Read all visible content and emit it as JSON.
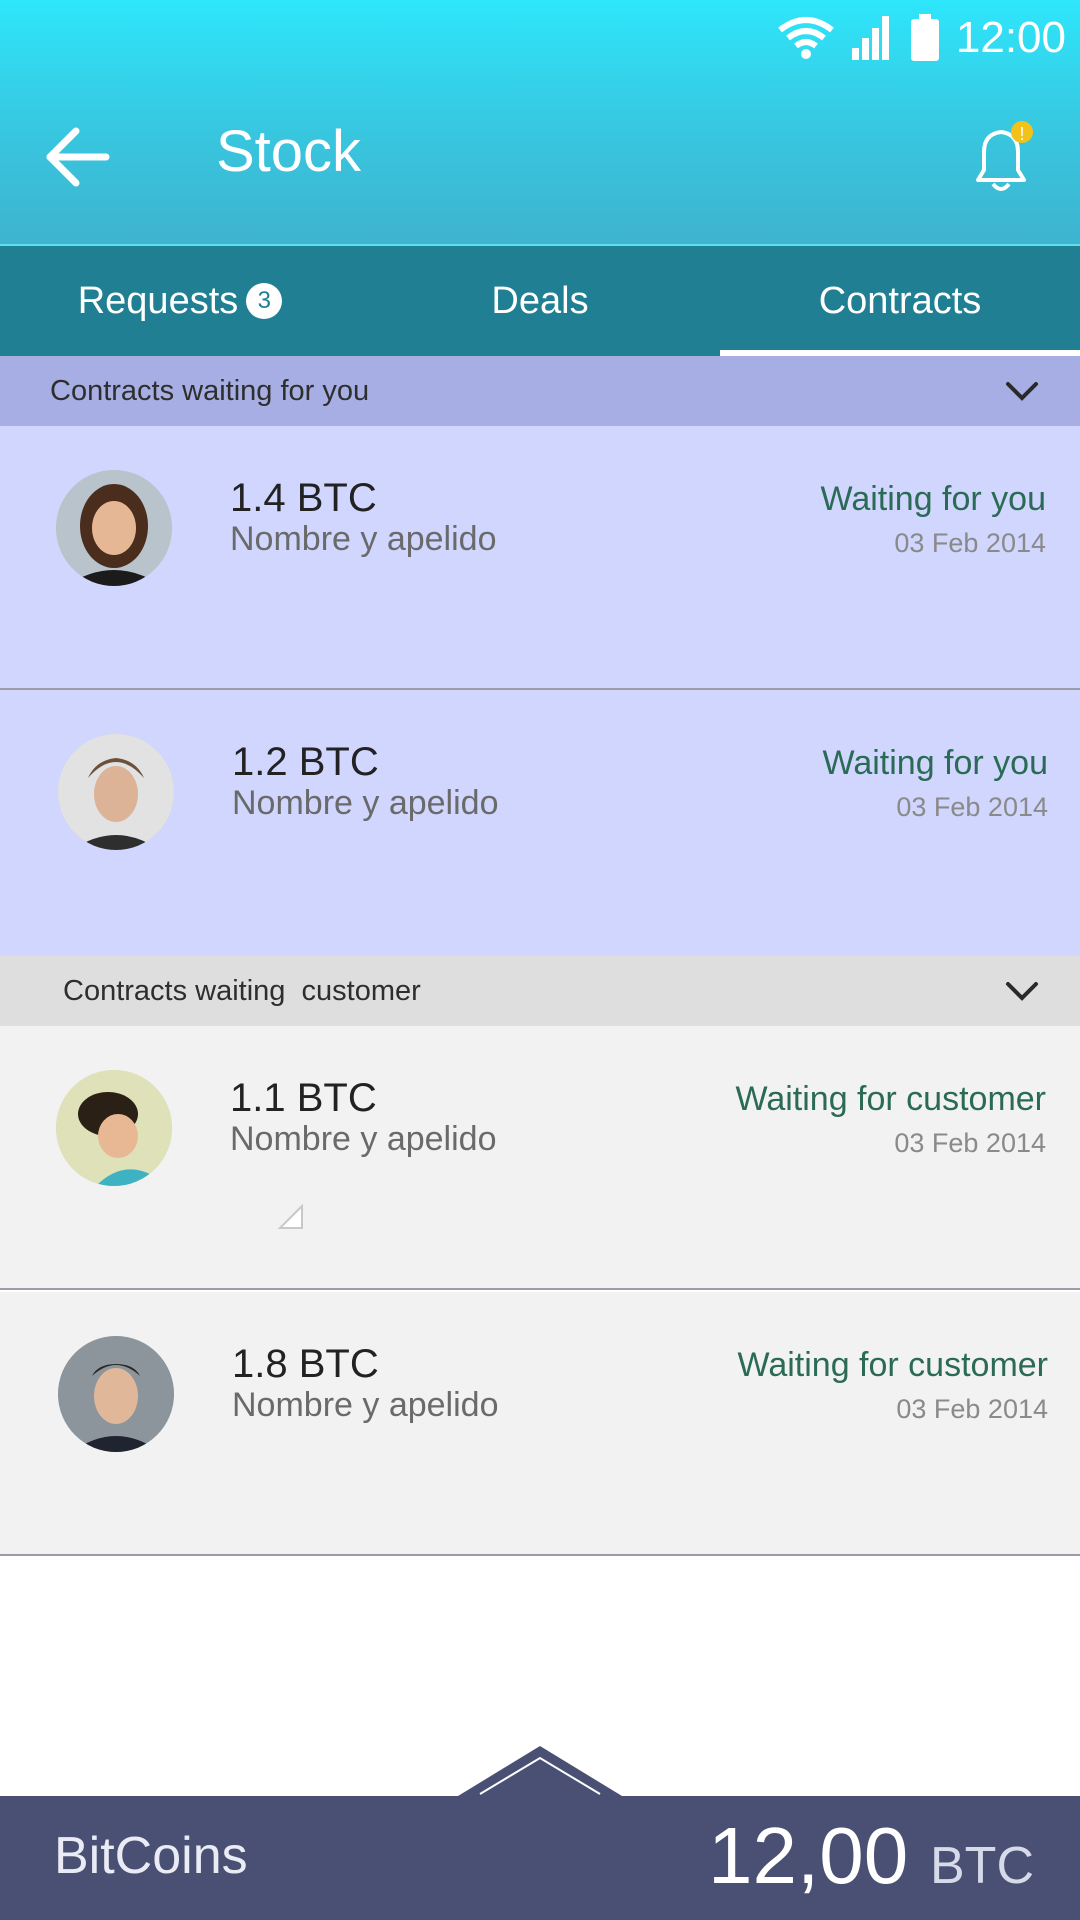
{
  "status_bar": {
    "time": "12:00",
    "icons": [
      "wifi-icon",
      "signal-icon",
      "battery-icon"
    ]
  },
  "header": {
    "title": "Stock",
    "back_icon": "arrow-left-icon",
    "bell_icon": "bell-icon",
    "bell_alert": "!"
  },
  "tabs": [
    {
      "label": "Requests",
      "badge": "3",
      "active": false
    },
    {
      "label": "Deals",
      "active": false
    },
    {
      "label": "Contracts",
      "active": true
    }
  ],
  "sections": [
    {
      "title": "Contracts waiting for you",
      "items": [
        {
          "amount": "1.4 BTC",
          "name": "Nombre y apelido",
          "status": "Waiting for you",
          "date": "03 Feb 2014"
        },
        {
          "amount": "1.2 BTC",
          "name": "Nombre y apelido",
          "status": "Waiting for you",
          "date": "03 Feb 2014"
        }
      ]
    },
    {
      "title": "Contracts waiting  customer",
      "items": [
        {
          "amount": "1.1 BTC",
          "name": "Nombre y apelido",
          "status": "Waiting for customer",
          "date": "03 Feb 2014"
        },
        {
          "amount": "1.8 BTC",
          "name": "Nombre y apelido",
          "status": "Waiting for customer",
          "date": "03 Feb 2014"
        }
      ]
    }
  ],
  "footer": {
    "label": "BitCoins",
    "value": "12,00",
    "unit": "BTC"
  },
  "colors": {
    "header_top": "#2ee6fb",
    "tabs": "#217f93",
    "section1": "#a7aee3",
    "row1": "#d0d6fe",
    "section2": "#dedede",
    "row2": "#f2f2f2",
    "footer": "#4a5073",
    "status_text": "#2b6a55"
  }
}
